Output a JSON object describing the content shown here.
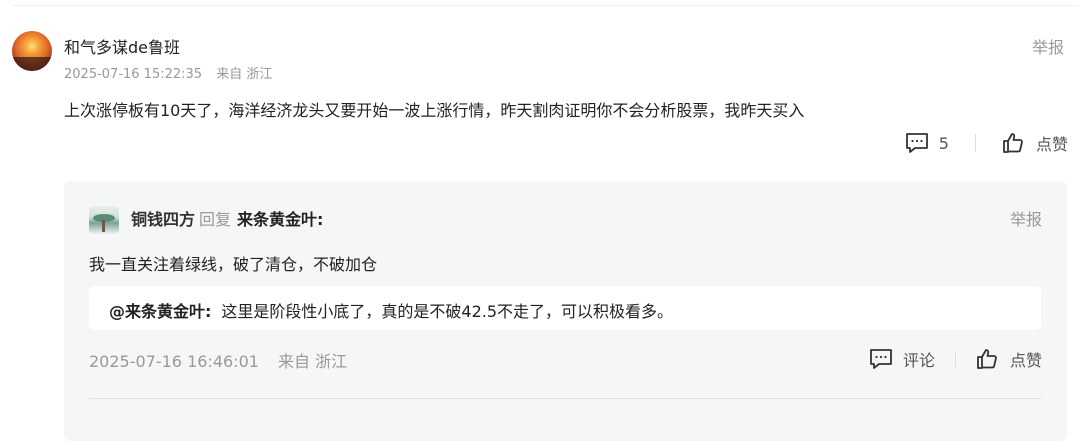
{
  "comment": {
    "username": "和气多谋de鲁班",
    "timestamp": "2025-07-16 15:22:35",
    "location": "来自 浙江",
    "report_label": "举报",
    "content": "上次涨停板有10天了，海洋经济龙头又要开始一波上涨行情，昨天割肉证明你不会分析股票，我昨天买入",
    "reply_count": "5",
    "like_label": "点赞"
  },
  "reply": {
    "username": "铜钱四方",
    "verb": "回复",
    "target": "来条黄金叶:",
    "report_label": "举报",
    "content": "我一直关注着绿线，破了清仓，不破加仓",
    "quote_name": "@来条黄金叶:",
    "quote_text": "这里是阶段性小底了，真的是不破42.5不走了，可以积极看多。",
    "timestamp": "2025-07-16 16:46:01",
    "location": "来自 浙江",
    "comment_label": "评论",
    "like_label": "点赞"
  },
  "icons": {
    "avatar_main": "sunset-avatar",
    "avatar_reply": "landscape-avatar",
    "comment": "comment-icon",
    "like": "thumbs-up-icon"
  }
}
